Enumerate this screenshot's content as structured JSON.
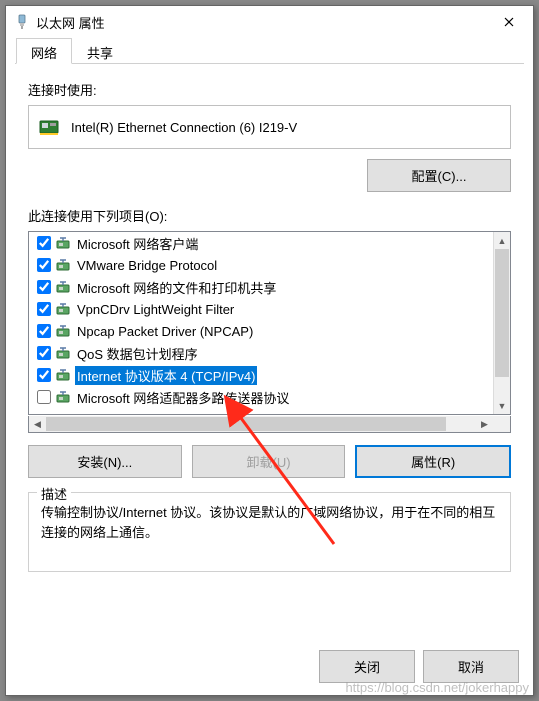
{
  "window": {
    "title": "以太网 属性",
    "icon": "network-plug-icon"
  },
  "tabs": [
    {
      "label": "网络",
      "active": true
    },
    {
      "label": "共享",
      "active": false
    }
  ],
  "connect_using_label": "连接时使用:",
  "adapter_name": "Intel(R) Ethernet Connection (6) I219-V",
  "configure_btn": "配置(C)...",
  "items_label": "此连接使用下列项目(O):",
  "items": [
    {
      "checked": true,
      "selected": false,
      "label": "Microsoft 网络客户端"
    },
    {
      "checked": true,
      "selected": false,
      "label": "VMware Bridge Protocol"
    },
    {
      "checked": true,
      "selected": false,
      "label": "Microsoft 网络的文件和打印机共享"
    },
    {
      "checked": true,
      "selected": false,
      "label": "VpnCDrv LightWeight Filter"
    },
    {
      "checked": true,
      "selected": false,
      "label": "Npcap Packet Driver (NPCAP)"
    },
    {
      "checked": true,
      "selected": false,
      "label": "QoS 数据包计划程序"
    },
    {
      "checked": true,
      "selected": true,
      "label": "Internet 协议版本 4 (TCP/IPv4)"
    },
    {
      "checked": false,
      "selected": false,
      "label": "Microsoft 网络适配器多路传送器协议"
    }
  ],
  "buttons": {
    "install": "安装(N)...",
    "uninstall": "卸载(U)",
    "properties": "属性(R)"
  },
  "desc_group": {
    "legend": "描述",
    "text": "传输控制协议/Internet 协议。该协议是默认的广域网络协议，用于在不同的相互连接的网络上通信。"
  },
  "footer": {
    "close": "关闭",
    "cancel": "取消"
  },
  "watermark": "https://blog.csdn.net/jokerhappy"
}
